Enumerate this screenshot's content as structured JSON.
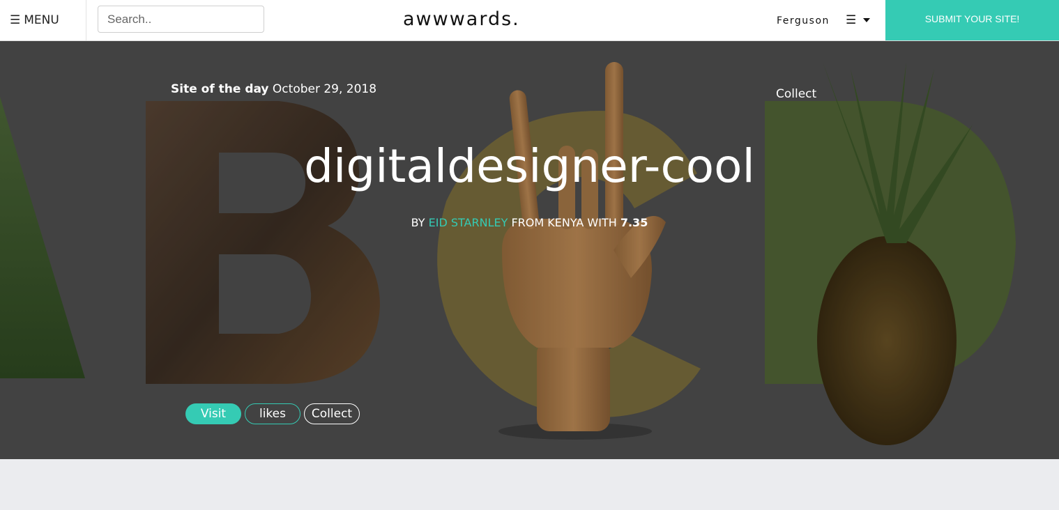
{
  "nav": {
    "menu_label": "MENU",
    "search_placeholder": "Search..",
    "logo": "awwwards.",
    "username": "Ferguson",
    "submit_label": "SUBMIT YOUR SITE!"
  },
  "hero": {
    "date_label": "Site of the day",
    "date": "October 29, 2018",
    "collect_top": "Collect",
    "title": "digitaldesigner-cool",
    "by_label": "BY",
    "author": "EID STARNLEY",
    "from_label": "FROM KENYA WITH",
    "score": "7.35",
    "buttons": {
      "visit": "Visit",
      "likes": "likes",
      "collect": "Collect"
    }
  },
  "colors": {
    "accent": "#35cbb4",
    "hero_bg": "#515151",
    "page_bg": "#ebecef"
  }
}
